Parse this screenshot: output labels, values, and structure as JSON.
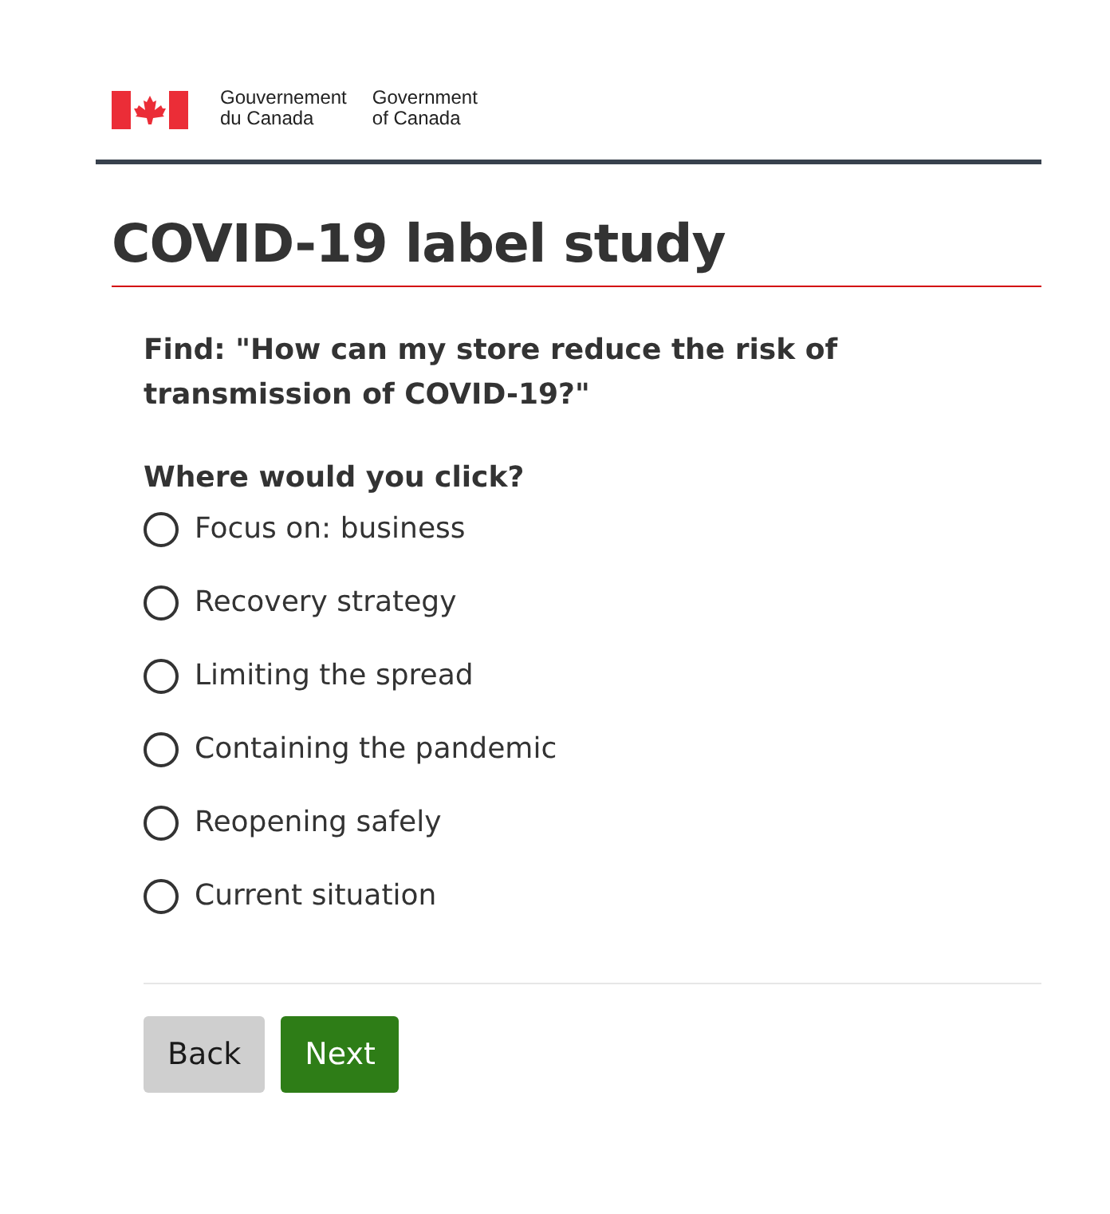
{
  "header": {
    "wordmark_fr": [
      "Gouvernement",
      "du Canada"
    ],
    "wordmark_en": [
      "Government",
      "of Canada"
    ]
  },
  "title": "COVID-19 label study",
  "task": "Find: \"How can my store reduce the risk of transmission of COVID-19?\"",
  "question": "Where would you click?",
  "options": [
    {
      "label": "Focus on: business",
      "selected": false
    },
    {
      "label": "Recovery strategy",
      "selected": false
    },
    {
      "label": "Limiting the spread",
      "selected": false
    },
    {
      "label": "Containing the pandemic",
      "selected": false
    },
    {
      "label": "Reopening safely",
      "selected": false
    },
    {
      "label": "Current situation",
      "selected": false
    }
  ],
  "buttons": [
    {
      "label": "Back",
      "kind": "secondary"
    },
    {
      "label": "Next",
      "kind": "primary"
    }
  ]
}
